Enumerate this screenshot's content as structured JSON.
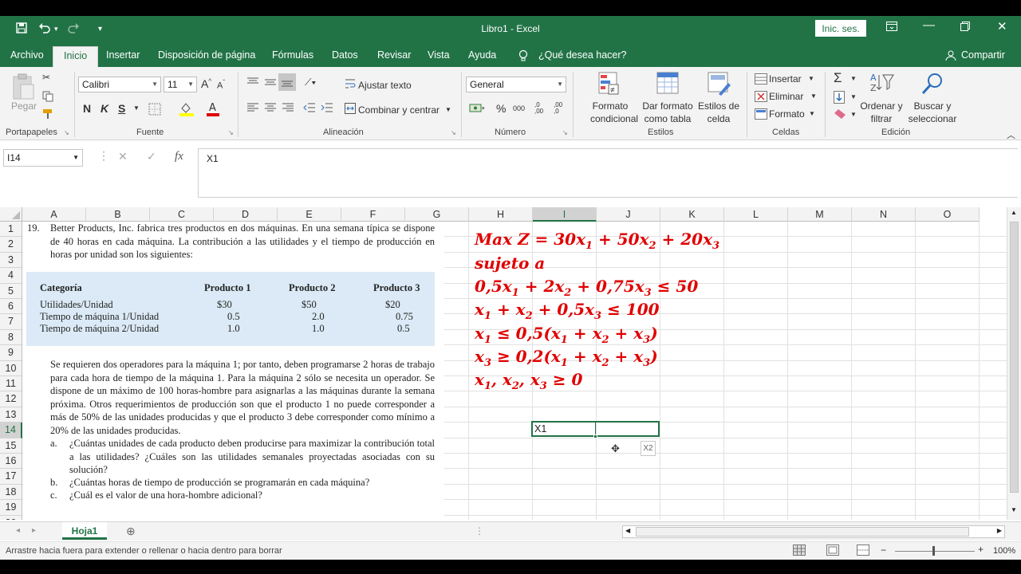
{
  "window": {
    "title": "Libro1  -  Excel",
    "signin_label": "Inic. ses."
  },
  "tabs": [
    {
      "label": "Archivo"
    },
    {
      "label": "Inicio"
    },
    {
      "label": "Insertar"
    },
    {
      "label": "Disposición de página"
    },
    {
      "label": "Fórmulas"
    },
    {
      "label": "Datos"
    },
    {
      "label": "Revisar"
    },
    {
      "label": "Vista"
    },
    {
      "label": "Ayuda"
    },
    {
      "label": "¿Qué desea hacer?"
    },
    {
      "label": "Compartir"
    }
  ],
  "ribbon": {
    "paste_label": "Pegar",
    "font_name": "Calibri",
    "font_size": "11",
    "wrap_text": "Ajustar texto",
    "merge_center": "Combinar y centrar",
    "number_format": "General",
    "cond_format": "Formato condicional",
    "format_table": "Dar formato como tabla",
    "cell_styles": "Estilos de celda",
    "insert": "Insertar",
    "delete": "Eliminar",
    "format": "Formato",
    "sort_filter": "Ordenar y filtrar",
    "find_select": "Buscar y seleccionar",
    "groups": {
      "portapapeles": "Portapapeles",
      "fuente": "Fuente",
      "alineacion": "Alineación",
      "numero": "Número",
      "estilos": "Estilos",
      "celdas": "Celdas",
      "edicion": "Edición"
    }
  },
  "formula_bar": {
    "name_box": "I14",
    "fx": "fx",
    "content": "X1"
  },
  "columns": [
    "A",
    "B",
    "C",
    "D",
    "E",
    "F",
    "G",
    "H",
    "I",
    "J",
    "K",
    "L",
    "M",
    "N",
    "O"
  ],
  "rows": [
    "1",
    "2",
    "3",
    "4",
    "5",
    "6",
    "7",
    "8",
    "9",
    "10",
    "11",
    "12",
    "13",
    "14",
    "15",
    "16",
    "17",
    "18",
    "19",
    "20"
  ],
  "problem": {
    "number": "19.",
    "intro": "Better Products, Inc. fabrica tres productos en dos máquinas. En una semana típica se dispone de 40 horas en cada máquina. La contribución a las utilidades y el tiempo de producción en horas por unidad son los siguientes:",
    "table": {
      "headers": [
        "Categoría",
        "Producto 1",
        "Producto 2",
        "Producto 3"
      ],
      "rows": [
        [
          "Utilidades/Unidad",
          "$30",
          "$50",
          "$20"
        ],
        [
          "Tiempo de máquina 1/Unidad",
          "0.5",
          "2.0",
          "0.75"
        ],
        [
          "Tiempo de máquina 2/Unidad",
          "1.0",
          "1.0",
          "0.5"
        ]
      ]
    },
    "body": "Se requieren dos operadores para la máquina 1; por tanto, deben programarse 2 horas de trabajo para cada hora de tiempo de la máquina 1. Para la máquina 2 sólo se necesita un operador. Se dispone de un máximo de 100 horas-hombre para asignarlas a las máquinas durante la semana próxima. Otros requerimientos de producción son que el producto 1 no puede corresponder a más de 50% de las unidades producidas y que el producto 3 debe corresponder como mínimo a 20% de las unidades producidas.",
    "questions": [
      {
        "letter": "a.",
        "text": "¿Cuántas unidades de cada producto deben producirse para maximizar la contribución total a las utilidades? ¿Cuáles son las utilidades semanales proyectadas asociadas con su solución?"
      },
      {
        "letter": "b.",
        "text": "¿Cuántas horas de tiempo de producción se programarán en cada máquina?"
      },
      {
        "letter": "c.",
        "text": "¿Cuál es el valor de una hora-hombre adicional?"
      }
    ]
  },
  "cells": {
    "i14": "X1",
    "autofill_tip": "X2"
  },
  "sheet": {
    "tab": "Hoja1"
  },
  "status": {
    "message": "Arrastre hacia fuera para extender o rellenar o hacia dentro para borrar",
    "zoom": "100%"
  },
  "colors": {
    "excel_green": "#217346",
    "math_red": "#e00000",
    "table_blue": "#dbeaf6"
  }
}
